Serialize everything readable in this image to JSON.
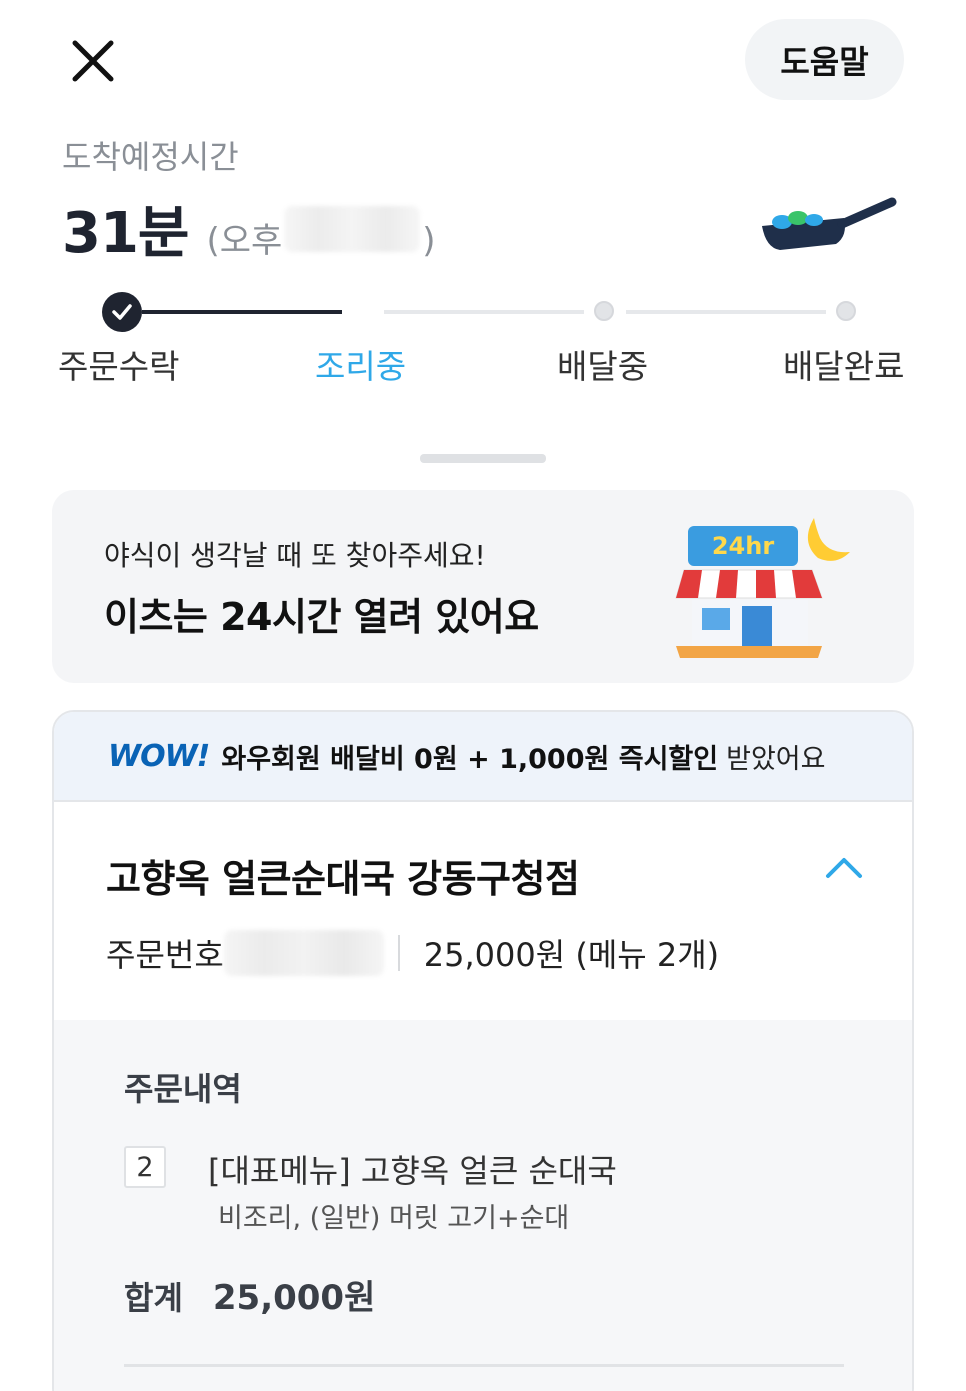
{
  "header": {
    "help_label": "도움말"
  },
  "eta": {
    "label": "도착예정시간",
    "minutes": "31분",
    "time_prefix": "(오후",
    "time_suffix": ")"
  },
  "progress": {
    "steps": [
      {
        "label": "주문수락",
        "state": "done"
      },
      {
        "label": "조리중",
        "state": "active"
      },
      {
        "label": "배달중",
        "state": "pending"
      },
      {
        "label": "배달완료",
        "state": "pending"
      }
    ]
  },
  "promo": {
    "subtitle": "야식이 생각날 때 또 찾아주세요!",
    "title": "이츠는 24시간 열려 있어요",
    "badge": "24hr"
  },
  "order": {
    "wow_logo": "WOW!",
    "wow_text_bold": "와우회원 배달비 0원 + 1,000원 즉시할인",
    "wow_text_plain": "받았어요",
    "store_name": "고향옥 얼큰순대국 강동구청점",
    "order_number_label": "주문번호",
    "order_summary": "25,000원 (메뉴 2개)",
    "details_title": "주문내역",
    "items": [
      {
        "qty": "2",
        "name": "[대표메뉴] 고향옥 얼큰 순대국",
        "option": "비조리, (일반) 머릿 고기+순대"
      }
    ],
    "total_label": "합계",
    "total_value": "25,000원"
  },
  "colors": {
    "accent": "#2fa8e8",
    "dark": "#1f2430",
    "wow_blue": "#0a63b5"
  }
}
